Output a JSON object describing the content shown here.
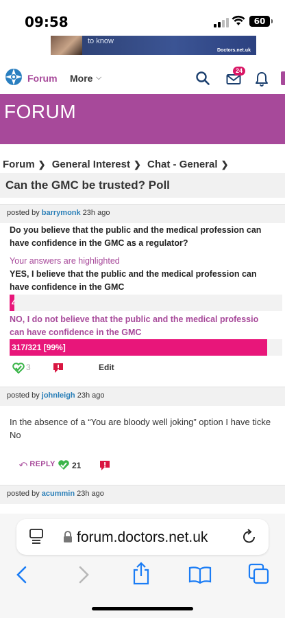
{
  "status_bar": {
    "time": "09:58",
    "battery": "60"
  },
  "ad": {
    "text": "to know",
    "brand": "Doctors.net.uk"
  },
  "nav": {
    "forum_label": "Forum",
    "more_label": "More",
    "mail_badge": "24"
  },
  "banner": {
    "title": "FORUM"
  },
  "breadcrumb": {
    "items": [
      "Forum",
      "General Interest",
      "Chat - General"
    ]
  },
  "thread": {
    "title": "Can the GMC be trusted? Poll"
  },
  "post1": {
    "posted_by": "posted by",
    "author": "barrymonk",
    "time": "23h ago",
    "question_line1": "Do you believe that the public and the medical profession can",
    "question_line2": "have confidence in the GMC as a regulator?",
    "highlight_note": "Your answers are highlighted",
    "option1_line1": "YES, I believe that the public and the medical profession can",
    "option1_line2": "have confidence in the GMC",
    "option1_bar_label": "4",
    "option1_fraction": 0.012,
    "option2_line1": "NO, I do not believe that the public and the medical professio",
    "option2_line2": "can have confidence in the GMC",
    "option2_bar_label": "317/321 [99%]",
    "option2_fraction": 0.99,
    "likes": "3",
    "edit_label": "Edit"
  },
  "post2": {
    "posted_by": "posted by",
    "author": "johnleigh",
    "time": "23h ago",
    "body_line1": "In the absence of a “You are bloody well joking” option I have ticke",
    "body_line2": "No",
    "reply_label": "REPLY",
    "likes": "21"
  },
  "post3": {
    "posted_by": "posted by",
    "author": "acummin",
    "time": "23h ago"
  },
  "browser": {
    "url": "forum.doctors.net.uk"
  },
  "colors": {
    "accent": "#a7499a",
    "poll_bar": "#e8167a",
    "link": "#2a7fb8",
    "like_green": "#3bb54a",
    "flag_red": "#d91641",
    "ios_blue": "#1a7cf5"
  }
}
